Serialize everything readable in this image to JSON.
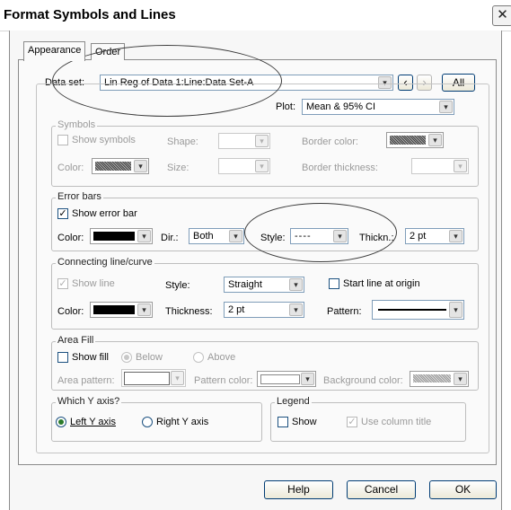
{
  "window": {
    "title": "Format Symbols and Lines",
    "close_glyph": "✕"
  },
  "tabs": [
    {
      "label": "Appearance"
    },
    {
      "label": "Order"
    }
  ],
  "dataset": {
    "label": "Data set:",
    "value": "Lin Reg of Data 1:Line:Data Set-A",
    "prev_glyph": "‹",
    "next_glyph": "›",
    "all_label": "All"
  },
  "plot": {
    "label": "Plot:",
    "value": "Mean & 95% CI"
  },
  "symbols": {
    "group_label": "Symbols",
    "show_label": "Show symbols",
    "shape_label": "Shape:",
    "border_color_label": "Border color:",
    "color_label": "Color:",
    "size_label": "Size:",
    "border_thickness_label": "Border thickness:"
  },
  "error_bars": {
    "group_label": "Error bars",
    "show_label": "Show error bar",
    "color_label": "Color:",
    "dir_label": "Dir.:",
    "dir_value": "Both",
    "style_label": "Style:",
    "style_value": "----",
    "thickness_label": "Thickn.:",
    "thickness_value": "2 pt"
  },
  "connecting": {
    "group_label": "Connecting line/curve",
    "show_label": "Show line",
    "style_label": "Style:",
    "style_value": "Straight",
    "start_origin_label": "Start line at origin",
    "color_label": "Color:",
    "thickness_label": "Thickness:",
    "thickness_value": "2 pt",
    "pattern_label": "Pattern:"
  },
  "area_fill": {
    "group_label": "Area Fill",
    "show_label": "Show fill",
    "below_label": "Below",
    "above_label": "Above",
    "area_pattern_label": "Area pattern:",
    "pattern_color_label": "Pattern color:",
    "background_color_label": "Background color:"
  },
  "y_axis": {
    "group_label": "Which Y axis?",
    "left_label": "Left Y axis",
    "right_label": "Right Y axis"
  },
  "legend": {
    "group_label": "Legend",
    "show_label": "Show",
    "use_column_title_label": "Use column title"
  },
  "buttons": {
    "help": "Help",
    "cancel": "Cancel",
    "ok": "OK"
  },
  "icons": {
    "dropdown": "▾",
    "check": "✓"
  }
}
